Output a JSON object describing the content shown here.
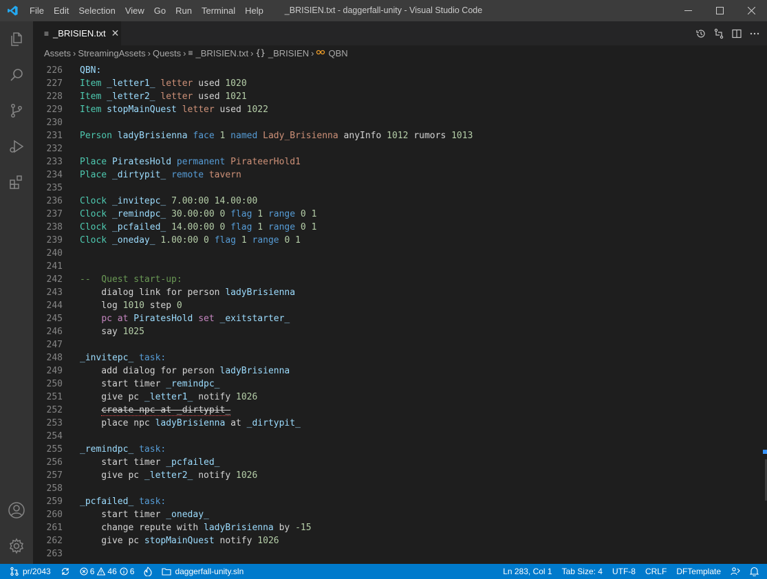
{
  "menu": [
    "File",
    "Edit",
    "Selection",
    "View",
    "Go",
    "Run",
    "Terminal",
    "Help"
  ],
  "window_title": "_BRISIEN.txt - daggerfall-unity - Visual Studio Code",
  "tab": {
    "label": "_BRISIEN.txt",
    "close": "✕"
  },
  "breadcrumbs": [
    "Assets",
    "StreamingAssets",
    "Quests",
    "_BRISIEN.txt",
    "_BRISIEN",
    "QBN"
  ],
  "colors": {
    "accent": "#007acc",
    "editor_bg": "#1e1e1e",
    "activity_bg": "#333333",
    "title_bg": "#3c3c3c"
  },
  "code": [
    {
      "n": "226",
      "t": [
        [
          "QBN:",
          "var"
        ]
      ]
    },
    {
      "n": "227",
      "t": [
        [
          "Item ",
          "kw"
        ],
        [
          "_letter1_ ",
          "var"
        ],
        [
          "letter ",
          "str"
        ],
        [
          "used ",
          ""
        ],
        [
          "1020",
          "num"
        ]
      ]
    },
    {
      "n": "228",
      "t": [
        [
          "Item ",
          "kw"
        ],
        [
          "_letter2_ ",
          "var"
        ],
        [
          "letter ",
          "str"
        ],
        [
          "used ",
          ""
        ],
        [
          "1021",
          "num"
        ]
      ]
    },
    {
      "n": "229",
      "t": [
        [
          "Item ",
          "kw"
        ],
        [
          "stopMainQuest ",
          "var"
        ],
        [
          "letter ",
          "str"
        ],
        [
          "used ",
          ""
        ],
        [
          "1022",
          "num"
        ]
      ]
    },
    {
      "n": "230",
      "t": []
    },
    {
      "n": "231",
      "t": [
        [
          "Person ",
          "kw"
        ],
        [
          "ladyBrisienna ",
          "var"
        ],
        [
          "face ",
          "kw2"
        ],
        [
          "1 ",
          "num"
        ],
        [
          "named ",
          "kw2"
        ],
        [
          "Lady_Brisienna ",
          "str"
        ],
        [
          "anyInfo ",
          ""
        ],
        [
          "1012 ",
          "num"
        ],
        [
          "rumors ",
          ""
        ],
        [
          "1013",
          "num"
        ]
      ]
    },
    {
      "n": "232",
      "t": []
    },
    {
      "n": "233",
      "t": [
        [
          "Place ",
          "kw"
        ],
        [
          "PiratesHold ",
          "var"
        ],
        [
          "permanent ",
          "kw2"
        ],
        [
          "PirateerHold1",
          "str"
        ]
      ]
    },
    {
      "n": "234",
      "t": [
        [
          "Place ",
          "kw"
        ],
        [
          "_dirtypit_ ",
          "var"
        ],
        [
          "remote ",
          "kw2"
        ],
        [
          "tavern",
          "str"
        ]
      ]
    },
    {
      "n": "235",
      "t": []
    },
    {
      "n": "236",
      "t": [
        [
          "Clock ",
          "kw"
        ],
        [
          "_invitepc_ ",
          "var"
        ],
        [
          "7.00:00 14.00:00",
          "num"
        ]
      ]
    },
    {
      "n": "237",
      "t": [
        [
          "Clock ",
          "kw"
        ],
        [
          "_remindpc_ ",
          "var"
        ],
        [
          "30.00:00 0 ",
          "num"
        ],
        [
          "flag ",
          "kw2"
        ],
        [
          "1 ",
          "num"
        ],
        [
          "range ",
          "kw2"
        ],
        [
          "0 1",
          "num"
        ]
      ]
    },
    {
      "n": "238",
      "t": [
        [
          "Clock ",
          "kw"
        ],
        [
          "_pcfailed_ ",
          "var"
        ],
        [
          "14.00:00 0 ",
          "num"
        ],
        [
          "flag ",
          "kw2"
        ],
        [
          "1 ",
          "num"
        ],
        [
          "range ",
          "kw2"
        ],
        [
          "0 1",
          "num"
        ]
      ]
    },
    {
      "n": "239",
      "t": [
        [
          "Clock ",
          "kw"
        ],
        [
          "_oneday_ ",
          "var"
        ],
        [
          "1.00:00 0 ",
          "num"
        ],
        [
          "flag ",
          "kw2"
        ],
        [
          "1 ",
          "num"
        ],
        [
          "range ",
          "kw2"
        ],
        [
          "0 1",
          "num"
        ]
      ]
    },
    {
      "n": "240",
      "t": []
    },
    {
      "n": "241",
      "t": []
    },
    {
      "n": "242",
      "t": [
        [
          "--  Quest start-up:",
          "cmt"
        ]
      ]
    },
    {
      "n": "243",
      "t": [
        [
          "    dialog link for person ",
          ""
        ],
        [
          "ladyBrisienna",
          "var"
        ]
      ]
    },
    {
      "n": "244",
      "t": [
        [
          "    log ",
          ""
        ],
        [
          "1010 ",
          "num"
        ],
        [
          "step ",
          ""
        ],
        [
          "0",
          "num"
        ]
      ]
    },
    {
      "n": "245",
      "t": [
        [
          "    ",
          ""
        ],
        [
          "pc at ",
          "pink"
        ],
        [
          "PiratesHold ",
          "var"
        ],
        [
          "set ",
          "pink"
        ],
        [
          "_exitstarter_",
          "var"
        ]
      ]
    },
    {
      "n": "246",
      "t": [
        [
          "    say ",
          ""
        ],
        [
          "1025",
          "num"
        ]
      ]
    },
    {
      "n": "247",
      "t": []
    },
    {
      "n": "248",
      "t": [
        [
          "_invitepc_ ",
          "var"
        ],
        [
          "task:",
          "kw2"
        ]
      ]
    },
    {
      "n": "249",
      "t": [
        [
          "    add dialog for person ",
          ""
        ],
        [
          "ladyBrisienna",
          "var"
        ]
      ]
    },
    {
      "n": "250",
      "t": [
        [
          "    start timer ",
          ""
        ],
        [
          "_remindpc_",
          "var"
        ]
      ]
    },
    {
      "n": "251",
      "t": [
        [
          "    give pc ",
          ""
        ],
        [
          "_letter1_ ",
          "var"
        ],
        [
          "notify ",
          ""
        ],
        [
          "1026",
          "num"
        ]
      ]
    },
    {
      "n": "252",
      "t": [
        [
          "    ",
          ""
        ],
        [
          "create npc at _dirtypit_",
          "strike"
        ]
      ]
    },
    {
      "n": "253",
      "t": [
        [
          "    place npc ",
          ""
        ],
        [
          "ladyBrisienna ",
          "var"
        ],
        [
          "at ",
          ""
        ],
        [
          "_dirtypit_",
          "var"
        ]
      ]
    },
    {
      "n": "254",
      "t": []
    },
    {
      "n": "255",
      "t": [
        [
          "_remindpc_ ",
          "var"
        ],
        [
          "task:",
          "kw2"
        ]
      ]
    },
    {
      "n": "256",
      "t": [
        [
          "    start timer ",
          ""
        ],
        [
          "_pcfailed_",
          "var"
        ]
      ]
    },
    {
      "n": "257",
      "t": [
        [
          "    give pc ",
          ""
        ],
        [
          "_letter2_ ",
          "var"
        ],
        [
          "notify ",
          ""
        ],
        [
          "1026",
          "num"
        ]
      ]
    },
    {
      "n": "258",
      "t": []
    },
    {
      "n": "259",
      "t": [
        [
          "_pcfailed_ ",
          "var"
        ],
        [
          "task:",
          "kw2"
        ]
      ]
    },
    {
      "n": "260",
      "t": [
        [
          "    start timer ",
          ""
        ],
        [
          "_oneday_",
          "var"
        ]
      ]
    },
    {
      "n": "261",
      "t": [
        [
          "    change repute with ",
          ""
        ],
        [
          "ladyBrisienna ",
          "var"
        ],
        [
          "by ",
          ""
        ],
        [
          "-15",
          "num"
        ]
      ]
    },
    {
      "n": "262",
      "t": [
        [
          "    give pc ",
          ""
        ],
        [
          "stopMainQuest ",
          "var"
        ],
        [
          "notify ",
          ""
        ],
        [
          "1026",
          "num"
        ]
      ]
    },
    {
      "n": "263",
      "t": []
    }
  ],
  "status": {
    "branch": "pr/2043",
    "errors": "6",
    "warnings": "46",
    "infos": "6",
    "solution": "daggerfall-unity.sln",
    "position": "Ln 283, Col 1",
    "tab_size": "Tab Size: 4",
    "encoding": "UTF-8",
    "eol": "CRLF",
    "language": "DFTemplate"
  }
}
